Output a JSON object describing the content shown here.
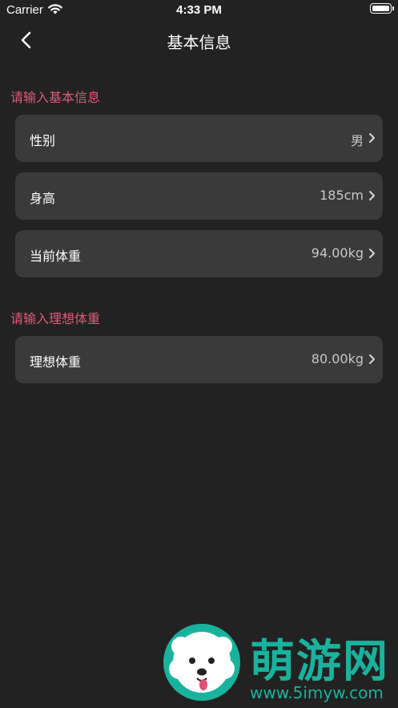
{
  "status_bar": {
    "carrier": "Carrier",
    "time": "4:33 PM"
  },
  "nav": {
    "title": "基本信息"
  },
  "sections": [
    {
      "header": "请输入基本信息",
      "rows": [
        {
          "label": "性别",
          "value": "男"
        },
        {
          "label": "身高",
          "value": "185cm"
        },
        {
          "label": "当前体重",
          "value": "94.00kg"
        }
      ]
    },
    {
      "header": "请输入理想体重",
      "rows": [
        {
          "label": "理想体重",
          "value": "80.00kg"
        }
      ]
    }
  ],
  "watermark": {
    "brand": "萌游网",
    "url": "www.5imyw.com"
  },
  "colors": {
    "background": "#222222",
    "row": "#3a3a3a",
    "accent": "#e05a78",
    "watermark": "#19b39d"
  },
  "icons": {
    "back": "chevron-left-icon",
    "row": "chevron-right-icon",
    "wifi": "wifi-icon",
    "battery": "battery-icon"
  }
}
